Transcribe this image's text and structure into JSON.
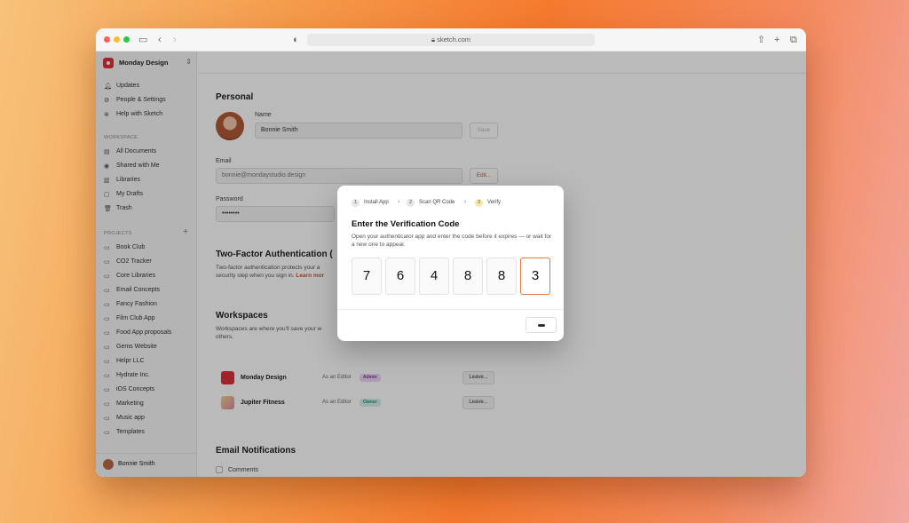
{
  "browser": {
    "url": "sketch.com"
  },
  "sidebar": {
    "workspace_name": "Monday Design",
    "top_items": [
      {
        "label": "Updates",
        "icon": "bell-icon"
      },
      {
        "label": "People & Settings",
        "icon": "gear-icon"
      },
      {
        "label": "Help with Sketch",
        "icon": "help-icon"
      }
    ],
    "workspace_section": "WORKSPACE",
    "workspace_items": [
      {
        "label": "All Documents",
        "icon": "document-icon"
      },
      {
        "label": "Shared with Me",
        "icon": "person-icon"
      },
      {
        "label": "Libraries",
        "icon": "library-icon"
      },
      {
        "label": "My Drafts",
        "icon": "drafts-icon"
      },
      {
        "label": "Trash",
        "icon": "trash-icon"
      }
    ],
    "projects_section": "PROJECTS",
    "projects": [
      "Book Club",
      "CO2 Tracker",
      "Core Libraries",
      "Email Concepts",
      "Fancy Fashion",
      "Film Club App",
      "Food App proposals",
      "Gems Website",
      "Helpr LLC",
      "Hydrate Inc.",
      "iOS Concepts",
      "Marketing",
      "Music app",
      "Templates"
    ],
    "user_name": "Bonnie Smith"
  },
  "main": {
    "personal_title": "Personal",
    "name_label": "Name",
    "name_value": "Bonnie Smith",
    "save_label": "Save",
    "email_label": "Email",
    "email_value": "bonnie@mondaystudio.design",
    "edit_label": "Edit...",
    "password_label": "Password",
    "password_value": "••••••••",
    "twofa_title": "Two-Factor Authentication (",
    "twofa_desc_1": "Two-factor authentication protects your a",
    "twofa_desc_2": "security step when you sign in.",
    "twofa_link": "Learn mor",
    "workspaces_title": "Workspaces",
    "workspaces_desc_1": "Workspaces are where you'll save your w",
    "workspaces_desc_2": "others.",
    "workspaces": [
      {
        "name": "Monday Design",
        "role": "As an Editor",
        "badge": "Admin",
        "leave": "Leave...",
        "color": "#e0303c",
        "badge_bg": "#ecd9f2",
        "badge_fg": "#8a3aa6"
      },
      {
        "name": "Jupiter Fitness",
        "role": "As an Editor",
        "badge": "Owner",
        "leave": "Leave...",
        "color": "#e8b24a",
        "badge_bg": "#d4efe9",
        "badge_fg": "#2a8a76"
      }
    ],
    "email_notifications_title": "Email Notifications",
    "comments_label": "Comments"
  },
  "modal": {
    "steps": [
      {
        "num": "1",
        "label": "Install App"
      },
      {
        "num": "2",
        "label": "Scan QR Code"
      },
      {
        "num": "3",
        "label": "Verify"
      }
    ],
    "title": "Enter the Verification Code",
    "description": "Open your authenticator app and enter the code before it expires — or wait for a new one to appear.",
    "code": [
      "7",
      "6",
      "4",
      "8",
      "8",
      "3"
    ]
  },
  "colors": {
    "accent": "#e07a3c",
    "brand_red": "#e0303c"
  }
}
